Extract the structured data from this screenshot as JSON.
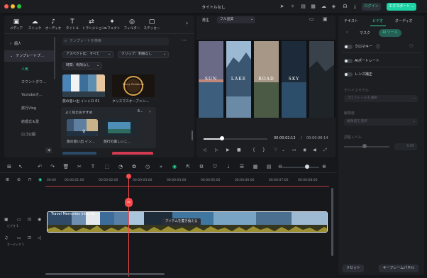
{
  "window": {
    "title": "タイトルなし",
    "login_label": "ログイン",
    "export_label": "エクスポート",
    "export_chevron": "⌄"
  },
  "colors": {
    "accent": "#2fdc9b",
    "export": "#1ed2a6",
    "playhead": "#ff4b4b"
  },
  "media_tabs": [
    {
      "label": "メディア",
      "icon": "media-icon",
      "glyph": "▣"
    },
    {
      "label": "ストック",
      "icon": "stock-icon",
      "glyph": "☁"
    },
    {
      "label": "オーディオ",
      "icon": "audio-icon",
      "glyph": "♪"
    },
    {
      "label": "タイトル",
      "icon": "title-icon",
      "glyph": "T"
    },
    {
      "label": "トランジション",
      "icon": "transition-icon",
      "glyph": "⇄"
    },
    {
      "label": "エフェクト",
      "icon": "effect-icon",
      "glyph": "✦"
    },
    {
      "label": "フィルター",
      "icon": "filter-icon",
      "glyph": "◎"
    },
    {
      "label": "ステッカー",
      "icon": "sticker-icon",
      "glyph": "▢"
    }
  ],
  "sidebar": {
    "items": [
      {
        "label": "個人",
        "prefix": "›"
      },
      {
        "label": "テンプレートプ...",
        "prefix": "⌄"
      },
      {
        "label": "人気",
        "prefix": ""
      },
      {
        "label": "カウントダウ...",
        "prefix": ""
      },
      {
        "label": "Youtubeオ...",
        "prefix": ""
      },
      {
        "label": "旅行Vlog",
        "prefix": ""
      },
      {
        "label": "結婚式＆愛",
        "prefix": ""
      },
      {
        "label": "ロゴ公開",
        "prefix": ""
      }
    ],
    "collapse_glyph": "◀"
  },
  "search": {
    "placeholder": "テンプレートを検索",
    "more_glyph": "···"
  },
  "filters": {
    "aspect": "アスペクト比：すべて",
    "clip": "クリップ：制限なし",
    "time": "時間：制限なし"
  },
  "templates": {
    "item1_caption": "旅の思い出 イントロ 01",
    "item2_caption": "クリスマスオープニン...",
    "item2_text": "Merry Christmas",
    "rec_title": "よく似たおすすめ",
    "rec_more": "6...",
    "rec1_caption": "旅の思い出 イン...",
    "rec2_caption": "旅行の美しいこ..."
  },
  "preview": {
    "label": "再生",
    "quality": "フル品質",
    "words": [
      "SUN",
      "LAKE",
      "ROAD",
      "SKY"
    ],
    "time_current": "00:00:02:13",
    "time_sep": "/",
    "time_total": "00:00:08:14"
  },
  "properties": {
    "tabs": [
      "テキスト",
      "ビデオ",
      "オーディオ"
    ],
    "active_tab": "ビデオ",
    "sub_mask": "マスク",
    "sub_ai": "AI ツール",
    "toggles": [
      "クロマキー",
      "AIポートレート",
      "レンズ補正"
    ],
    "device_model_label": "デバイスモデル",
    "device_model_value": "プロフィールを選択",
    "resolution_label": "解像度",
    "resolution_value": "解像度を選択",
    "level_label": "調整レベル",
    "level_value": "0.00",
    "level_fraction": 0.45,
    "reset_label": "リセット",
    "keyframe_label": "キーフレームパネル"
  },
  "timeline": {
    "ticks": [
      "00:00",
      "00:00:01:00",
      "00:00:02:00",
      "00:00:03:00",
      "00:00:04:00",
      "00:00:05:00",
      "00:00:06:00",
      "00:00:07:00",
      "00:00:08:00"
    ],
    "video_track_name": "ビデオ 1",
    "audio_track_name": "オーディオ 1",
    "clip_title": "Travel Memories Intro 01",
    "tooltip": "アイテムを置き換える"
  }
}
